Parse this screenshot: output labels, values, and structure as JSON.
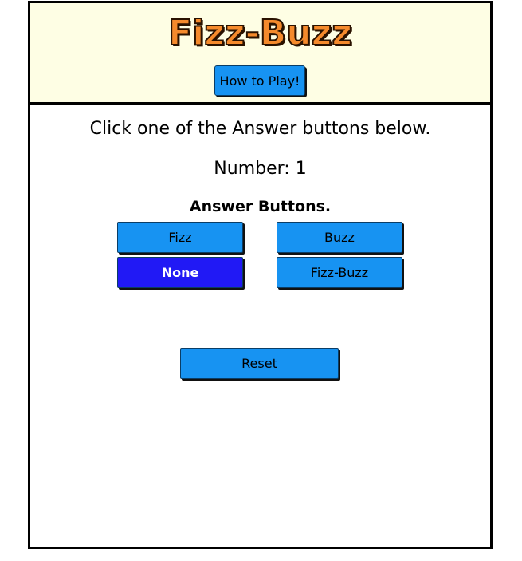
{
  "header": {
    "title": "Fizz-Buzz",
    "how_to_play_label": "How to Play!"
  },
  "main": {
    "instruction": "Click one of the Answer buttons below.",
    "number_label": "Number:",
    "number_value": "1",
    "answers_heading": "Answer Buttons.",
    "answers": {
      "fizz": "Fizz",
      "buzz": "Buzz",
      "none": "None",
      "fizz_buzz": "Fizz-Buzz"
    },
    "selected_answer": "None",
    "reset_label": "Reset"
  },
  "colors": {
    "header_background": "#fefee4",
    "title": "#f58a2c",
    "button": "#1793f2",
    "button_selected": "#2119f5"
  }
}
